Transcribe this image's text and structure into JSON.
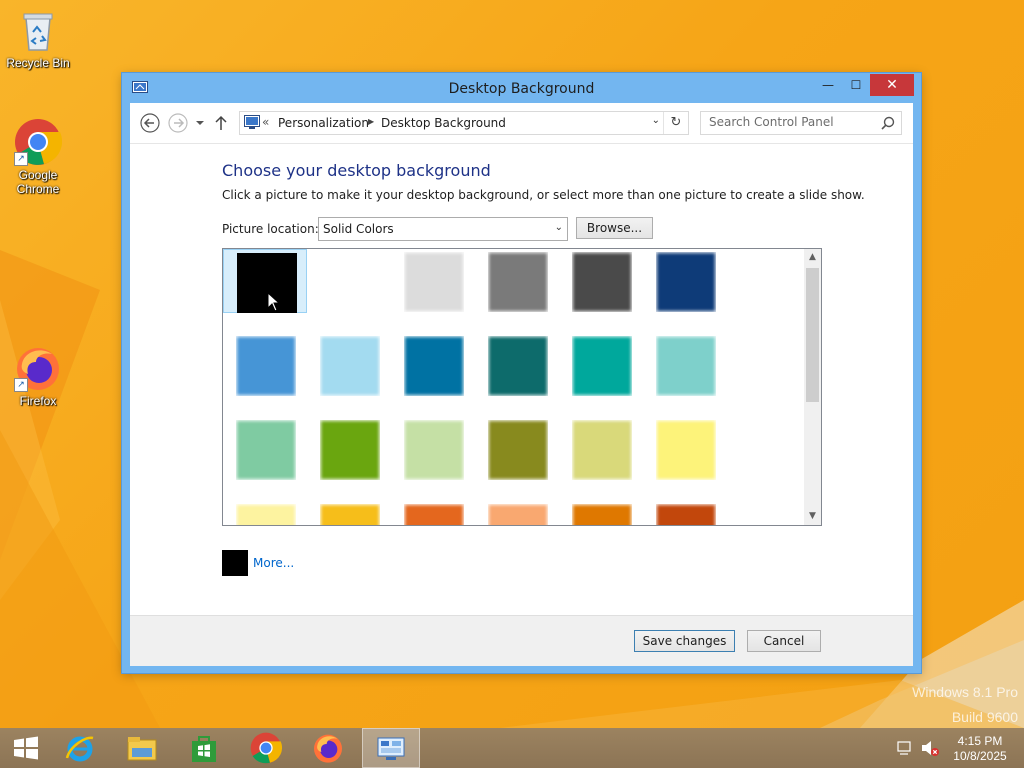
{
  "desktop": {
    "icons": [
      {
        "label": "Recycle Bin"
      },
      {
        "label": "Google\nChrome"
      },
      {
        "label": "Firefox"
      }
    ],
    "watermark": {
      "line1": "Windows 8.1 Pro",
      "line2": "Build 9600"
    }
  },
  "window": {
    "title": "Desktop Background",
    "controls": {
      "minimize": "—",
      "maximize": "☐",
      "close": "✕"
    },
    "address": {
      "overflow": "«",
      "crumbs": [
        "Personalization",
        "Desktop Background"
      ]
    },
    "search": {
      "placeholder": "Search Control Panel"
    },
    "heading": "Choose your desktop background",
    "description": "Click a picture to make it your desktop background, or select more than one picture to create a slide show.",
    "picture_location": {
      "label": "Picture location:",
      "value": "Solid Colors"
    },
    "browse_label": "Browse...",
    "swatches": [
      [
        "#000000",
        "#ffffff",
        "#dcdcdc",
        "#7a7a7a",
        "#4a4a4a",
        "#0e3b78"
      ],
      [
        "#4695d6",
        "#a3dbf0",
        "#0072a3",
        "#0d6b6b",
        "#00a89c",
        "#7ed0cb"
      ],
      [
        "#7fcba2",
        "#6aa60f",
        "#c5e0a5",
        "#888a1e",
        "#d9d97a",
        "#fdf37a"
      ],
      [
        "#fdf3a0",
        "#f6be1a",
        "#e4671e",
        "#f9a870",
        "#df7800",
        "#c2470c"
      ]
    ],
    "selected_swatch": {
      "row": 0,
      "col": 0
    },
    "more_label": "More...",
    "save_label": "Save changes",
    "cancel_label": "Cancel"
  },
  "taskbar": {
    "clock_time": "4:15 PM",
    "clock_date": "10/8/2025"
  }
}
